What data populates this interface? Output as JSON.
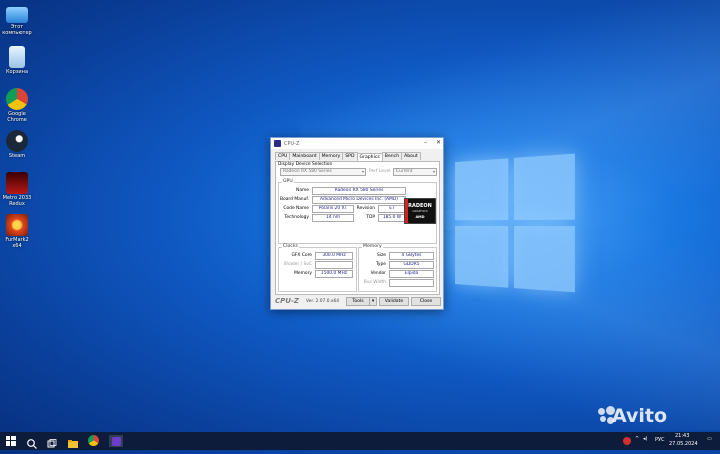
{
  "desktop_icons": [
    {
      "label": "Этот компьютер"
    },
    {
      "label": "Корзина"
    },
    {
      "label": "Google Chrome"
    },
    {
      "label": "Steam"
    },
    {
      "label": "Metro 2033 Redux"
    },
    {
      "label": "FurMark2 x64"
    }
  ],
  "window": {
    "title": "CPU-Z",
    "tabs": [
      "CPU",
      "Mainboard",
      "Memory",
      "SPD",
      "Graphics",
      "Bench",
      "About"
    ],
    "active_tab": "Graphics",
    "display_device_selection": {
      "group_label": "Display Device Selection",
      "device": "Radeon RX 580 Series",
      "perf_level_label": "Perf Level",
      "perf_level": "Current"
    },
    "gpu": {
      "group_label": "GPU",
      "name_label": "Name",
      "name": "Radeon RX 580 Series",
      "board_label": "Board Manuf.",
      "board": "Advanced Micro Devices Inc. (AMD)",
      "code_label": "Code Name",
      "code": "Polaris 20 XT",
      "revision_label": "Revision",
      "revision": "E7",
      "tech_label": "Technology",
      "tech": "14 nm",
      "tdp_label": "TDP",
      "tdp": "185.0 W",
      "logo_text": "RADEON",
      "logo_sub": "GRAPHICS",
      "logo_brand": "AMD"
    },
    "clocks": {
      "group_label": "Clocks",
      "gfx_label": "GFX Core",
      "gfx": "300.0 MHz",
      "shader_label": "Shader / SoC",
      "shader": "",
      "memory_label": "Memory",
      "memory": "1500.0 MHz"
    },
    "memory": {
      "group_label": "Memory",
      "size_label": "Size",
      "size": "4 GBytes",
      "type_label": "Type",
      "type": "GDDR5",
      "vendor_label": "Vendor",
      "vendor": "Elpida",
      "bus_label": "Bus Width",
      "bus": ""
    },
    "footer": {
      "brand": "CPU-Z",
      "version": "Ver. 2.07.0.x64",
      "tools": "Tools",
      "validate": "Validate",
      "close": "Close"
    }
  },
  "taskbar": {
    "language": "РУС",
    "time": "21:43",
    "date": "27.05.2024"
  },
  "watermark": "Avito",
  "colors": {
    "desktop": "#0f58c2",
    "taskbar": "#0c1c3a",
    "value_text": "#1a1a8a"
  }
}
